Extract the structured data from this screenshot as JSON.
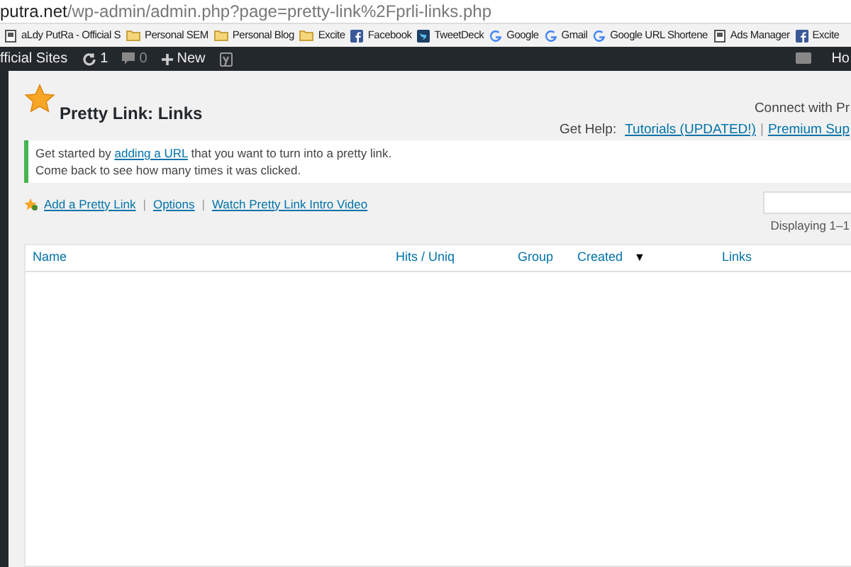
{
  "address_bar": {
    "host": "putra.net",
    "path": "/wp-admin/admin.php?page=pretty-link%2Fprli-links.php"
  },
  "bookmarks": [
    {
      "kind": "page",
      "label": "aLdy PutRa - Official S"
    },
    {
      "kind": "folder",
      "label": "Personal SEM"
    },
    {
      "kind": "folder",
      "label": "Personal Blog"
    },
    {
      "kind": "folder",
      "label": "Excite"
    },
    {
      "kind": "facebook",
      "label": "Facebook"
    },
    {
      "kind": "tweetdeck",
      "label": "TweetDeck"
    },
    {
      "kind": "google",
      "label": "Google"
    },
    {
      "kind": "google",
      "label": "Gmail"
    },
    {
      "kind": "google",
      "label": "Google URL Shortene"
    },
    {
      "kind": "page",
      "label": "Ads Manager"
    },
    {
      "kind": "facebook",
      "label": "Excite"
    }
  ],
  "admin_bar": {
    "site": "fficial Sites",
    "updates": "1",
    "comments": "0",
    "new": "New",
    "right": "Ho"
  },
  "page": {
    "title": "Pretty Link: Links",
    "connect": "Connect with Pr",
    "help_label": "Get Help:",
    "help_links": [
      "Tutorials (UPDATED!)",
      "Premium Sup"
    ],
    "separator": "|",
    "notice": [
      "Get started by ",
      "adding a URL",
      " that you want to turn into a pretty link.",
      "Come back to see how many times it was clicked."
    ],
    "actions": [
      "Add a Pretty Link",
      "Options",
      "Watch Pretty Link Intro Video"
    ],
    "displaying": "Displaying 1–1"
  },
  "table": {
    "columns": [
      {
        "label": "Name",
        "sorted": false
      },
      {
        "label": "Hits / Uniq",
        "sorted": false
      },
      {
        "label": "Group",
        "sorted": false
      },
      {
        "label": "Created",
        "sorted": true
      },
      {
        "label": "Links",
        "sorted": false
      }
    ],
    "sort_indicator": "▼"
  }
}
